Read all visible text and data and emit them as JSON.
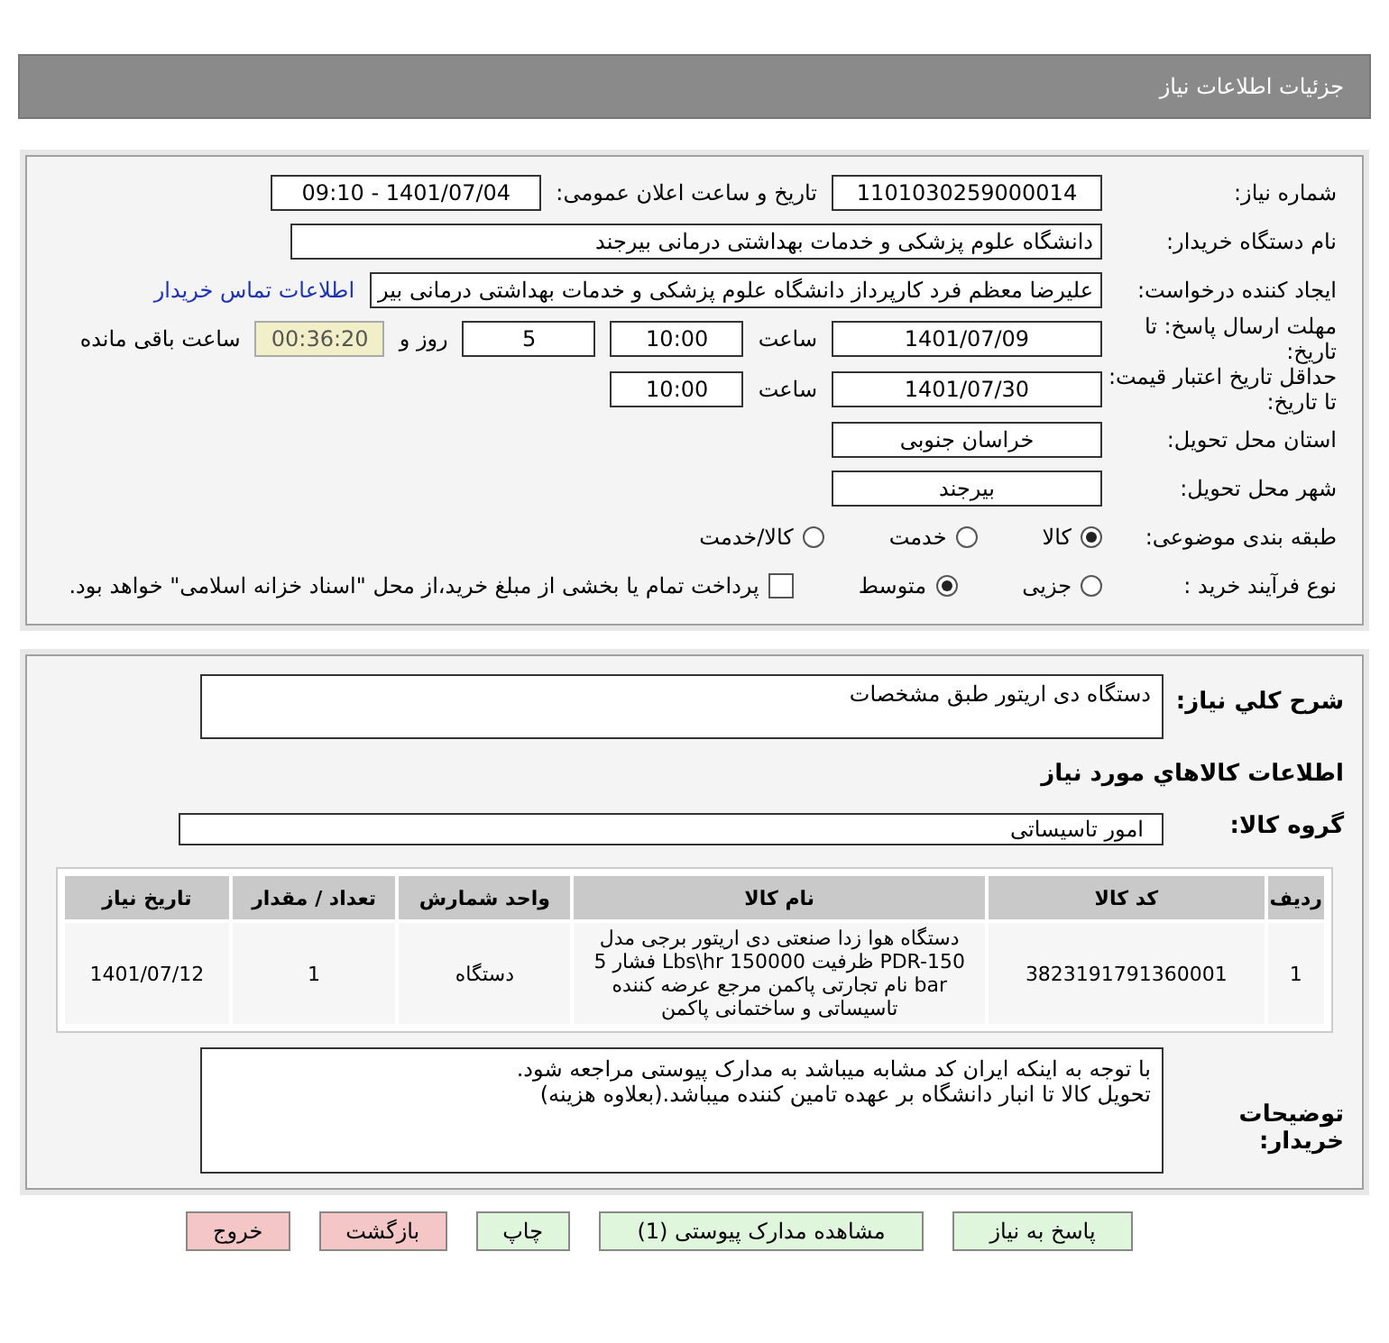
{
  "header": {
    "title": "جزئیات اطلاعات نیاز"
  },
  "form_rows": [
    {
      "label": "شماره نیاز:",
      "items": [
        {
          "kind": "field",
          "value": "1101030259000014"
        },
        {
          "kind": "text",
          "value": "تاریخ و ساعت اعلان عمومی:"
        },
        {
          "kind": "field",
          "value": "1401/07/04 - 09:10"
        }
      ]
    },
    {
      "label": "نام دستگاه خریدار:",
      "items": [
        {
          "kind": "wide-field",
          "value": "دانشگاه علوم پزشکی و خدمات بهداشتی درمانی بیرجند"
        }
      ]
    },
    {
      "label": "ایجاد کننده درخواست:",
      "items": [
        {
          "kind": "long-field",
          "value": "علیرضا معظم فرد کارپرداز دانشگاه علوم پزشکی و خدمات بهداشتی درمانی بیر"
        },
        {
          "kind": "link",
          "value": "اطلاعات تماس خریدار"
        }
      ]
    },
    {
      "label": "مهلت ارسال پاسخ: تا تاریخ:",
      "items": [
        {
          "kind": "field",
          "value": "1401/07/09"
        },
        {
          "kind": "text",
          "value": "ساعت"
        },
        {
          "kind": "short-field",
          "value": "10:00"
        },
        {
          "kind": "short-field",
          "value": "5"
        },
        {
          "kind": "text",
          "value": "روز و"
        },
        {
          "kind": "timer",
          "value": "00:36:20"
        },
        {
          "kind": "text",
          "value": "ساعت باقی مانده"
        }
      ]
    },
    {
      "label": "حداقل تاریخ اعتبار قیمت: تا تاریخ:",
      "items": [
        {
          "kind": "field",
          "value": "1401/07/30"
        },
        {
          "kind": "text",
          "value": "ساعت"
        },
        {
          "kind": "short-field",
          "value": "10:00"
        }
      ]
    },
    {
      "label": "استان محل تحویل:",
      "items": [
        {
          "kind": "field",
          "value": "خراسان جنوبی"
        }
      ]
    },
    {
      "label": "شهر محل تحویل:",
      "items": [
        {
          "kind": "field",
          "value": "بیرجند"
        }
      ]
    },
    {
      "label": "طبقه بندی موضوعی:",
      "items": [
        {
          "kind": "radio",
          "value": "کالا",
          "selected": true
        },
        {
          "kind": "radio",
          "value": "خدمت",
          "selected": false
        },
        {
          "kind": "radio",
          "value": "کالا/خدمت",
          "selected": false
        }
      ]
    },
    {
      "label": "نوع فرآیند خرید :",
      "items": [
        {
          "kind": "radio",
          "value": "جزیی",
          "selected": false
        },
        {
          "kind": "radio",
          "value": "متوسط",
          "selected": true
        },
        {
          "kind": "checkbox",
          "value": "پرداخت تمام یا بخشی از مبلغ خرید،از محل \"اسناد خزانه اسلامی\" خواهد بود.",
          "checked": false
        }
      ]
    }
  ],
  "summary": {
    "label": "شرح كلي نياز:",
    "value": "دستگاه دی اریتور طبق مشخصات"
  },
  "goods_title": "اطلاعات كالاهاي مورد نياز",
  "goods_group": {
    "label": "گروه كالا:",
    "value": "امور تاسیساتی"
  },
  "table": {
    "columns": [
      "ردیف",
      "کد کالا",
      "نام کالا",
      "واحد شمارش",
      "تعداد / مقدار",
      "تاریخ نیاز"
    ],
    "rows": [
      [
        "1",
        "3823191791360001",
        "دستگاه هوا زدا صنعتی دی اریتور برجی مدل PDR-150 ظرفیت 150000 Lbs\\hr فشار 5 bar نام تجارتی پاکمن مرجع عرضه کننده تاسیساتی و ساختمانی پاکمن",
        "دستگاه",
        "1",
        "1401/07/12"
      ]
    ]
  },
  "buyer_notes": {
    "label": "توضیحات خریدار:",
    "lines": [
      "با توجه به اینکه ایران کد مشابه میباشد به مدارک پیوستی مراجعه شود.",
      "تحویل کالا تا انبار دانشگاه بر عهده تامین کننده میباشد.(بعلاوه هزینه)"
    ]
  },
  "buttons": [
    {
      "label": "پاسخ به نیاز",
      "kind": "action"
    },
    {
      "label": "مشاهده مدارک پیوستی (1)",
      "kind": "action"
    },
    {
      "label": "چاپ",
      "kind": "action"
    },
    {
      "label": "بازگشت",
      "kind": "exit"
    },
    {
      "label": "خروج",
      "kind": "exit"
    }
  ]
}
